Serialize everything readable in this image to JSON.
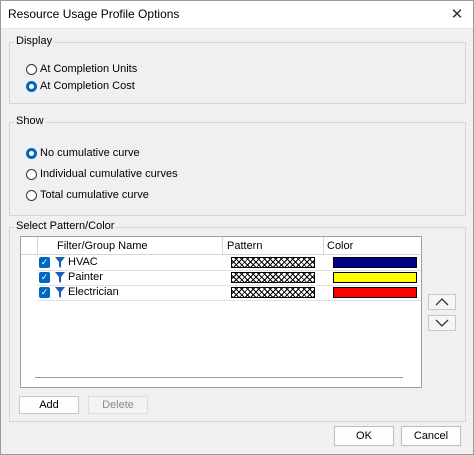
{
  "dialog": {
    "title": "Resource Usage Profile Options",
    "close_glyph": "✕"
  },
  "display": {
    "legend": "Display",
    "options": [
      {
        "label": "At Completion Units",
        "checked": false
      },
      {
        "label": "At Completion Cost",
        "checked": true
      }
    ]
  },
  "show": {
    "legend": "Show",
    "options": [
      {
        "label": "No cumulative curve",
        "checked": true
      },
      {
        "label": "Individual cumulative curves",
        "checked": false
      },
      {
        "label": "Total cumulative curve",
        "checked": false
      }
    ]
  },
  "pattern_color": {
    "legend": "Select Pattern/Color",
    "columns": [
      "Filter/Group Name",
      "Pattern",
      "Color"
    ],
    "rows": [
      {
        "name": "HVAC",
        "checked": true,
        "pattern": "crosshatch",
        "color": "#00008b"
      },
      {
        "name": "Painter",
        "checked": true,
        "pattern": "crosshatch",
        "color": "#ffff00"
      },
      {
        "name": "Electrician",
        "checked": true,
        "pattern": "crosshatch",
        "color": "#ff0000"
      }
    ]
  },
  "buttons": {
    "add": "Add",
    "delete": "Delete",
    "ok": "OK",
    "cancel": "Cancel",
    "move_up_icon": "chevron-up-icon",
    "move_down_icon": "chevron-down-icon"
  },
  "check_glyph": "✓"
}
